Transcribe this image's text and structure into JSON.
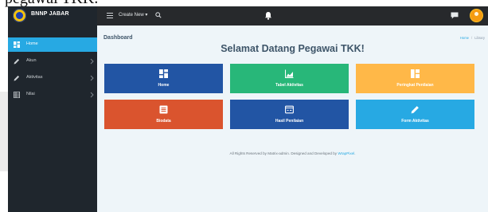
{
  "caption_cutoff": "pegawai TKK.",
  "brand": {
    "name": "BNNP JABAR"
  },
  "topbar": {
    "create_new": "Create New ▾"
  },
  "sidebar": {
    "items": [
      {
        "label": "Home",
        "icon": "dashboard-icon",
        "active": true
      },
      {
        "label": "Akun",
        "icon": "pencil-icon",
        "active": false
      },
      {
        "label": "Aktivitas",
        "icon": "pencil-icon",
        "active": false
      },
      {
        "label": "Nilai",
        "icon": "grid-icon",
        "active": false
      }
    ]
  },
  "main": {
    "page_title": "Dashboard",
    "welcome": "Selamat Datang Pegawai TKK!",
    "breadcrumb": {
      "home": "Home",
      "current": "Library"
    },
    "tiles": [
      {
        "label": "Home",
        "color": "#2255a4",
        "icon": "dashboard-icon"
      },
      {
        "label": "Tabel Aktivitas",
        "color": "#28b779",
        "icon": "chart-area-icon"
      },
      {
        "label": "Peringkat Penilaian",
        "color": "#ffb848",
        "icon": "board-icon"
      },
      {
        "label": "Biodata",
        "color": "#da542e",
        "icon": "note-icon"
      },
      {
        "label": "Hasil Penilaian",
        "color": "#2255a4",
        "icon": "window-icon"
      },
      {
        "label": "Form Aktivitas",
        "color": "#27a9e3",
        "icon": "pencil-icon"
      }
    ],
    "footer": {
      "text": "All Rights Reserved by Matrix-admin. Designed and Developed by ",
      "link": "WrapPixel",
      "suffix": "."
    }
  },
  "colors": {
    "topbar": "#27292c",
    "sidebar": "#1f262d",
    "accent": "#27a9e3",
    "main_bg": "#eef5f9"
  }
}
